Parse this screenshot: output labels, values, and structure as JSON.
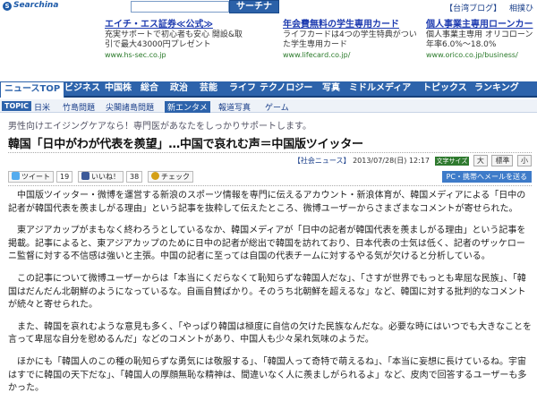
{
  "header": {
    "logo_text": "Searchina",
    "search_placeholder": "",
    "search_button": "サーチナ",
    "links": [
      "【台湾ブログ】",
      "相撲ひ"
    ]
  },
  "ads": [
    {
      "title": "エイチ・エス証券≪公式≫",
      "text": "充実サポートで初心者も安心 開設&取引で最大43000円プレゼント",
      "url": "www.hs-sec.co.jp"
    },
    {
      "title": "年会費無料の学生専用カード",
      "text": "ライフカードは4つの学生特典がついた学生専用カード",
      "url": "www.lifecard.co.jp/"
    },
    {
      "title": "個人事業主専用ローンカー",
      "text": "個人事業主専用 オリコローン年率6.0%〜18.0%",
      "url": "www.orico.co.jp/business/"
    }
  ],
  "nav": {
    "items": [
      "ニュースTOP",
      "ビジネス",
      "中国株",
      "総合",
      "政治",
      "芸能",
      "ライフ",
      "テクノロジー",
      "写真",
      "ミドルメディア",
      "トピックス",
      "ランキング"
    ]
  },
  "topics": {
    "label": "TOPIC",
    "items": [
      "日米",
      "竹島問題",
      "尖閣諸島問題",
      "新エンタメ",
      "報道写真",
      "ゲーム"
    ]
  },
  "article": {
    "subtitle": "男性向けエイジングケアなら！専門医があなたをしっかりサポートします。",
    "headline": "韓国「日中がわが代表を羨望」…中国で哀れむ声＝中国版ツイッター",
    "category": "【社会ニュース】",
    "date": "2013/07/28(日) 12:17",
    "badge": "文字サイズ",
    "sizes": [
      "大",
      "標準",
      "小"
    ],
    "social": {
      "tweet": "ツイート",
      "tweet_count": "19",
      "like": "いいね！",
      "like_count": "38",
      "check": "チェック",
      "mail": "PC・携帯へメールを送る"
    },
    "paragraphs": [
      "中国版ツイッター・微博を運営する新浪のスポーツ情報を専門に伝えるアカウント・新浪体育が、韓国メディアによる「日中の記者が韓国代表を羨ましがる理由」という記事を抜粋して伝えたところ、微博ユーザーからさまざまなコメントが寄せられた。",
      "東アジアカップがまもなく終わろうとしているなか、韓国メディアが「日中の記者が韓国代表を羨ましがる理由」という記事を掲載。記事によると、東アジアカップのために日中の記者が総出で韓国を訪れており、日本代表の士気は低く、記者のザッケローニ監督に対する不信感は強いと主張。中国の記者に至っては自国の代表チームに対するやる気が欠けると分析している。",
      "この記事について微博ユーザーからは「本当にくだらなくて恥知らずな韓国人だな」、「さすが世界でもっとも卑屈な民族」、「韓国はだんだん北朝鮮のようになっているな。自画自賛ばかり。そのうち北朝鮮を超えるな」など、韓国に対する批判的なコメントが続々と寄せられた。",
      "また、韓国を哀れむような意見も多く、「やっぱり韓国は極度に自信の欠けた民族なんだな。必要な時にはいつでも大きなことを言って卑屈な自分を慰めるんだ」などのコメントがあり、中国人も少々呆れ気味のようだ。",
      "ほかにも「韓国人のこの種の恥知らずな勇気には敬服する」、「韓国人って奇特で萌えるね」、「本当に妄想に長けているね。宇宙はすでに韓国の天下だな」、「韓国人の厚顔無恥な精神は、間違いなく人に羨ましがられるよ」など、皮肉で回答するユーザーも多かった。"
    ]
  }
}
